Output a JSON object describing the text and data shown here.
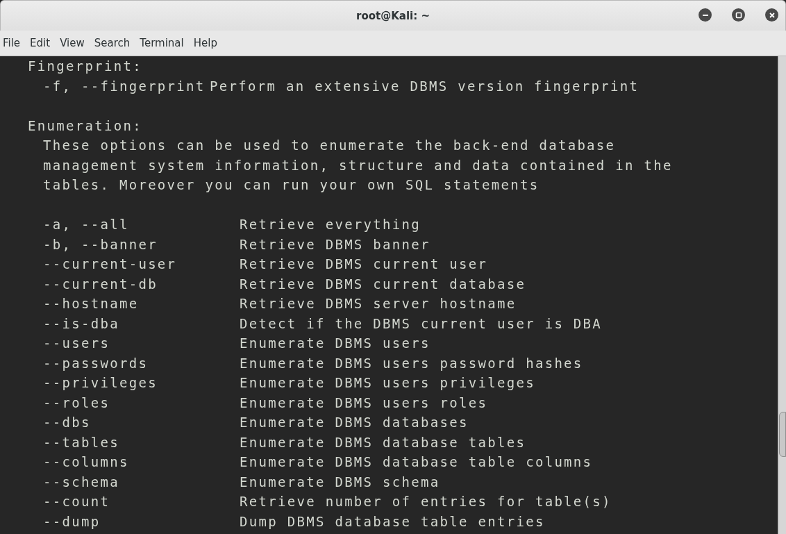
{
  "window": {
    "title": "root@Kali: ~"
  },
  "menu": [
    "File",
    "Edit",
    "View",
    "Search",
    "Terminal",
    "Help"
  ],
  "sections": [
    {
      "heading": "Fingerprint:",
      "options": [
        {
          "option": "-f, --fingerprint",
          "description": "Perform an extensive DBMS version fingerprint"
        }
      ]
    },
    {
      "heading": "Enumeration:",
      "intro": [
        "These options can be used to enumerate the back-end database",
        "management system information, structure and data contained in the",
        "tables. Moreover you can run your own SQL statements"
      ],
      "options": [
        {
          "option": "-a, --all",
          "description": "Retrieve everything"
        },
        {
          "option": "-b, --banner",
          "description": "Retrieve DBMS banner"
        },
        {
          "option": "--current-user",
          "description": "Retrieve DBMS current user"
        },
        {
          "option": "--current-db",
          "description": "Retrieve DBMS current database"
        },
        {
          "option": "--hostname",
          "description": "Retrieve DBMS server hostname"
        },
        {
          "option": "--is-dba",
          "description": "Detect if the DBMS current user is DBA"
        },
        {
          "option": "--users",
          "description": "Enumerate DBMS users"
        },
        {
          "option": "--passwords",
          "description": "Enumerate DBMS users password hashes"
        },
        {
          "option": "--privileges",
          "description": "Enumerate DBMS users privileges"
        },
        {
          "option": "--roles",
          "description": "Enumerate DBMS users roles"
        },
        {
          "option": "--dbs",
          "description": "Enumerate DBMS databases"
        },
        {
          "option": "--tables",
          "description": "Enumerate DBMS database tables"
        },
        {
          "option": "--columns",
          "description": "Enumerate DBMS database table columns"
        },
        {
          "option": "--schema",
          "description": "Enumerate DBMS schema"
        },
        {
          "option": "--count",
          "description": "Retrieve number of entries for table(s)"
        },
        {
          "option": "--dump",
          "description": "Dump DBMS database table entries"
        }
      ]
    }
  ]
}
